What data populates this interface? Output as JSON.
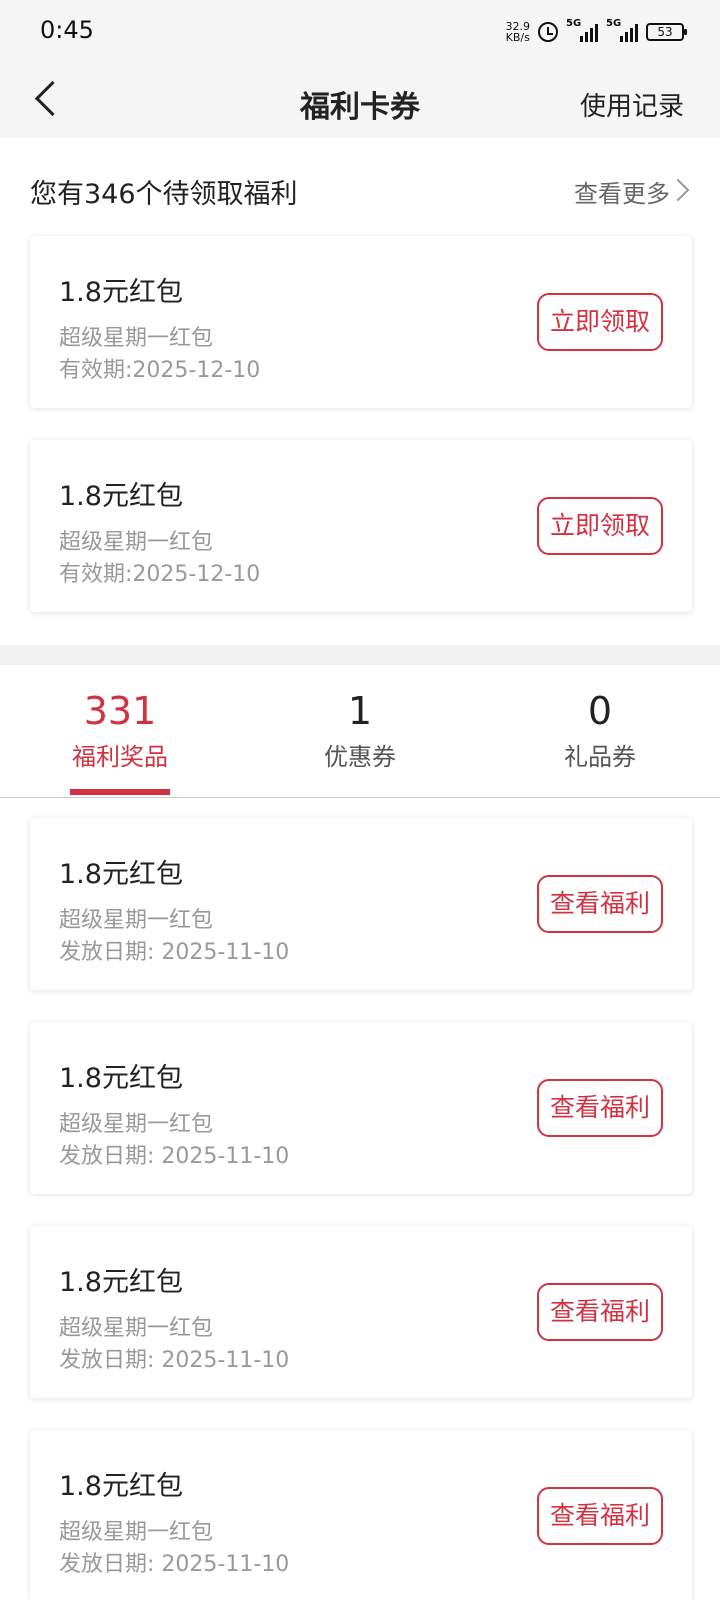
{
  "status_bar": {
    "time": "0:45",
    "net_speed_value": "32.9",
    "net_speed_unit": "KB/s",
    "signal1": "5G",
    "signal2": "5G",
    "battery": "53"
  },
  "nav": {
    "title": "福利卡券",
    "record_label": "使用记录"
  },
  "pending": {
    "title": "您有346个待领取福利",
    "more_label": "查看更多",
    "items": [
      {
        "title": "1.8元红包",
        "subtitle": "超级星期一红包",
        "date": "有效期:2025-12-10",
        "button": "立即领取"
      },
      {
        "title": "1.8元红包",
        "subtitle": "超级星期一红包",
        "date": "有效期:2025-12-10",
        "button": "立即领取"
      }
    ]
  },
  "tabs": [
    {
      "count": "331",
      "label": "福利奖品",
      "active": true
    },
    {
      "count": "1",
      "label": "优惠券",
      "active": false
    },
    {
      "count": "0",
      "label": "礼品券",
      "active": false
    }
  ],
  "rewards": [
    {
      "title": "1.8元红包",
      "subtitle": "超级星期一红包",
      "date": "发放日期: 2025-11-10",
      "button": "查看福利"
    },
    {
      "title": "1.8元红包",
      "subtitle": "超级星期一红包",
      "date": "发放日期: 2025-11-10",
      "button": "查看福利"
    },
    {
      "title": "1.8元红包",
      "subtitle": "超级星期一红包",
      "date": "发放日期: 2025-11-10",
      "button": "查看福利"
    },
    {
      "title": "1.8元红包",
      "subtitle": "超级星期一红包",
      "date": "发放日期: 2025-11-10",
      "button": "查看福利"
    }
  ],
  "colors": {
    "accent": "#d23240",
    "header_bg": "#f5f5f5",
    "muted_text": "#999999"
  }
}
